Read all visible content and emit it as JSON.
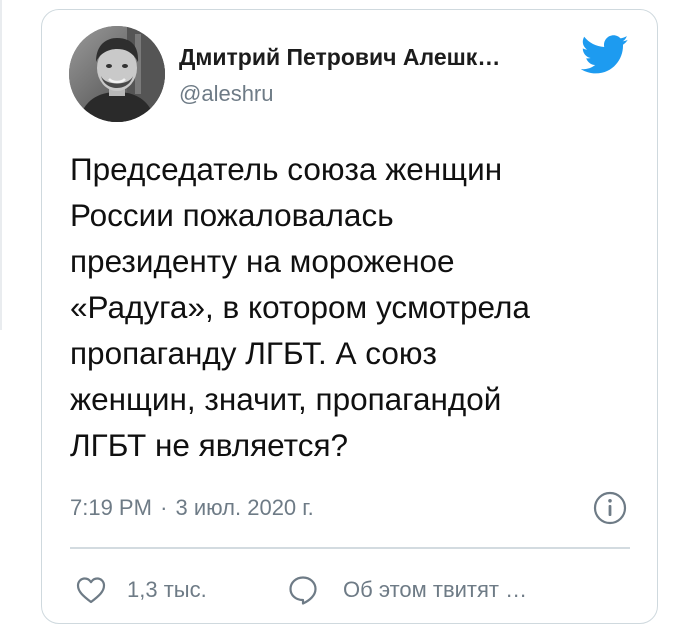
{
  "author": {
    "name": "Дмитрий Петрович Алешк…",
    "handle": "@aleshru"
  },
  "tweet": {
    "text": "Председатель союза женщин\nРоссии пожаловалась\nпрезиденту на мороженое\n«Радуга», в котором усмотрела\nпропаганду ЛГБТ. А союз\nженщин, значит, пропагандой\nЛГБТ не является?"
  },
  "meta": {
    "time": "7:19 PM",
    "separator": "·",
    "date": "3 июл. 2020 г."
  },
  "actions": {
    "likes_count": "1,3 тыс.",
    "reply_label": "Об этом твитят …"
  },
  "icons": {
    "brand": "twitter-bird-icon",
    "info": "info-icon",
    "like": "heart-icon",
    "reply": "speech-bubble-icon"
  },
  "colors": {
    "brand_blue": "#1d9bf0",
    "secondary_text": "#6e7b86",
    "card_border": "#cfd9de",
    "primary_text": "#101010"
  }
}
